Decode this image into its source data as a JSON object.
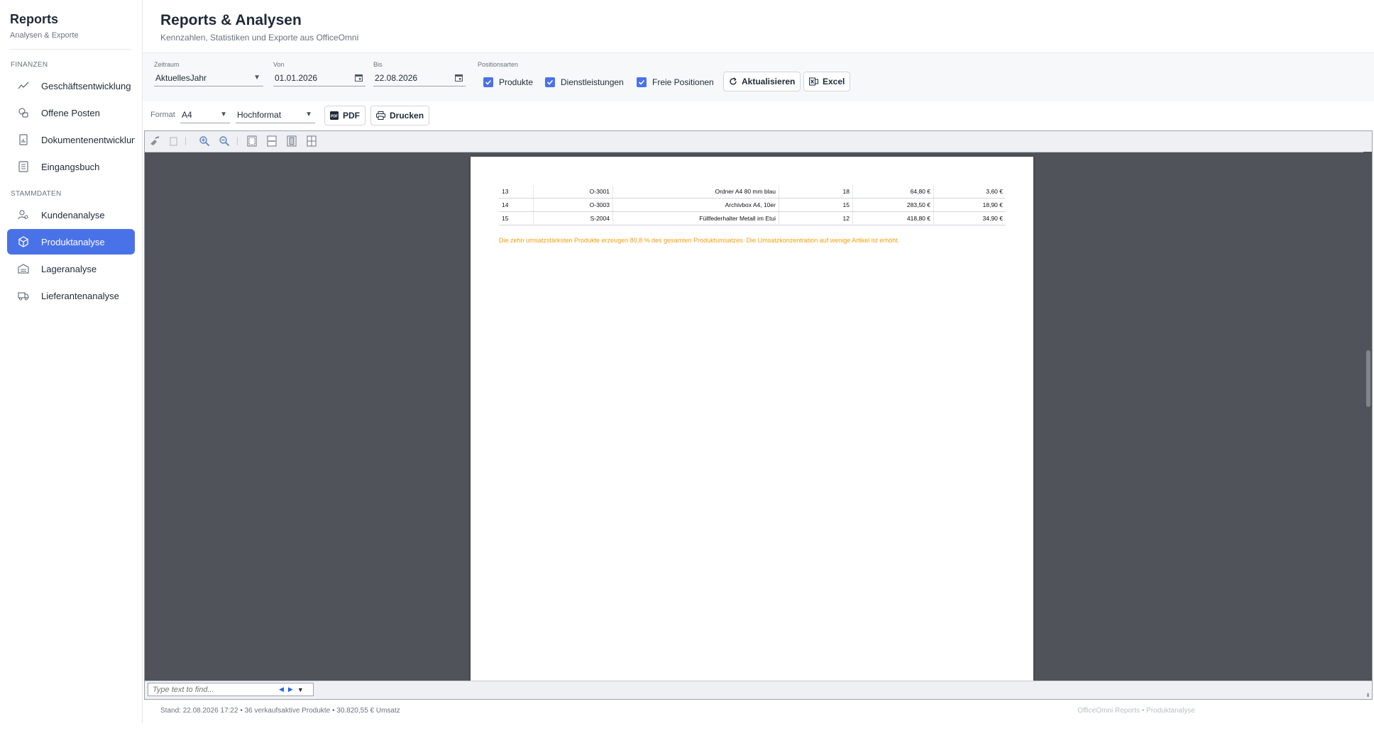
{
  "sidebar": {
    "title": "Reports",
    "subtitle": "Analysen & Exporte",
    "sections": [
      {
        "label": "FINANZEN"
      },
      {
        "label": "STAMMDATEN"
      }
    ],
    "items": [
      {
        "label": "Geschäftsentwicklung",
        "icon": "trend-line-icon"
      },
      {
        "label": "Offene Posten",
        "icon": "coins-icon"
      },
      {
        "label": "Dokumentenentwicklung",
        "icon": "document-chart-icon"
      },
      {
        "label": "Eingangsbuch",
        "icon": "list-book-icon"
      },
      {
        "label": "Kundenanalyse",
        "icon": "user-search-icon"
      },
      {
        "label": "Produktanalyse",
        "icon": "cube-icon",
        "active": true
      },
      {
        "label": "Lageranalyse",
        "icon": "warehouse-icon"
      },
      {
        "label": "Lieferantenanalyse",
        "icon": "truck-icon"
      }
    ]
  },
  "header": {
    "title": "Reports & Analysen",
    "subtitle": "Kennzahlen, Statistiken und Exporte aus OfficeOmni"
  },
  "filters": {
    "zeitraum_label": "Zeitraum",
    "zeitraum_value": "AktuellesJahr",
    "von_label": "Von",
    "von_value": "01.01.2026",
    "bis_label": "Bis",
    "bis_value": "22.08.2026",
    "positionsarten_label": "Positionsarten",
    "checkboxes": [
      {
        "label": "Produkte",
        "checked": true
      },
      {
        "label": "Dienstleistungen",
        "checked": true
      },
      {
        "label": "Freie Positionen",
        "checked": true
      }
    ],
    "refresh_label": "Aktualisieren",
    "excel_label": "Excel"
  },
  "format_bar": {
    "format_label": "Format",
    "format_value": "A4",
    "orientation_value": "Hochformat",
    "pdf_label": "PDF",
    "print_label": "Drucken"
  },
  "viewer": {
    "table_rows": [
      [
        "13",
        "O-3001",
        "Ordner A4 80 mm blau",
        "18",
        "64,80 €",
        "3,60 €"
      ],
      [
        "14",
        "O-3003",
        "Archivbox A4, 10er",
        "15",
        "283,50 €",
        "18,90 €"
      ],
      [
        "15",
        "S-2004",
        "Füllfederhalter Metall im Etui",
        "12",
        "418,80 €",
        "34,90 €"
      ]
    ],
    "note": "Die zehn umsatzstärksten Produkte erzeugen 80,8 % des gesamten Produktumsatzes. Die Umsatzkonzentration auf wenige Artikel ist erhöht.",
    "find_placeholder": "Type text to find..."
  },
  "status": {
    "left": "Stand: 22.08.2026 17:22 • 36 verkaufsaktive Produkte • 30.820,55 € Umsatz",
    "right": "OfficeOmni Reports • Produktanalyse"
  },
  "colors": {
    "accent": "#4a72e8",
    "note": "#f59e0b",
    "viewer_bg": "#50545a"
  }
}
